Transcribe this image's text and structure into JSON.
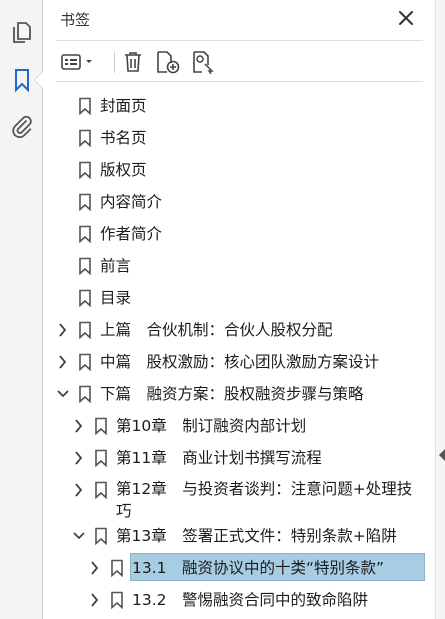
{
  "panel": {
    "title": "书签"
  },
  "colors": {
    "selected_bg": "#a7cde3",
    "accent_blue": "#1b6ac9",
    "icon_gray": "#555555"
  },
  "bookmarks": [
    {
      "label": "封面页",
      "level": 0,
      "expander": "none"
    },
    {
      "label": "书名页",
      "level": 0,
      "expander": "none"
    },
    {
      "label": "版权页",
      "level": 0,
      "expander": "none"
    },
    {
      "label": "内容简介",
      "level": 0,
      "expander": "none"
    },
    {
      "label": "作者简介",
      "level": 0,
      "expander": "none"
    },
    {
      "label": "前言",
      "level": 0,
      "expander": "none"
    },
    {
      "label": "目录",
      "level": 0,
      "expander": "none"
    },
    {
      "label": "上篇　合伙机制：合伙人股权分配",
      "level": 0,
      "expander": "collapsed"
    },
    {
      "label": "中篇　股权激励：核心团队激励方案设计",
      "level": 0,
      "expander": "collapsed"
    },
    {
      "label": "下篇　融资方案：股权融资步骤与策略",
      "level": 0,
      "expander": "expanded"
    },
    {
      "label": "第10章　制订融资内部计划",
      "level": 1,
      "expander": "collapsed"
    },
    {
      "label": "第11章　商业计划书撰写流程",
      "level": 1,
      "expander": "collapsed"
    },
    {
      "label": "第12章　与投资者谈判：注意问题+处理技巧",
      "level": 1,
      "expander": "collapsed",
      "wrap": true
    },
    {
      "label": "第13章　签署正式文件：特别条款+陷阱",
      "level": 1,
      "expander": "expanded"
    },
    {
      "label": "13.1　融资协议中的十类“特别条款”",
      "level": 2,
      "expander": "collapsed",
      "selected": true
    },
    {
      "label": "13.2　警惕融资合同中的致命陷阱",
      "level": 2,
      "expander": "collapsed"
    }
  ]
}
